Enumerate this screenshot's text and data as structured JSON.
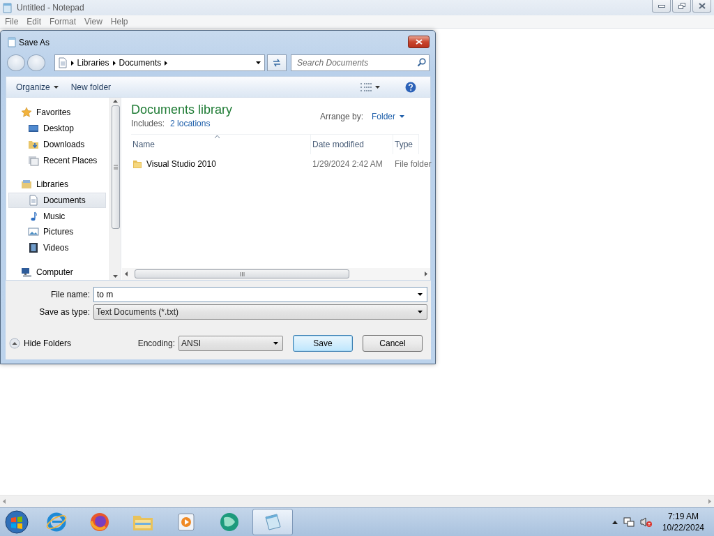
{
  "notepad": {
    "title": "Untitled - Notepad",
    "active": false,
    "menu": [
      "File",
      "Edit",
      "Format",
      "View",
      "Help"
    ]
  },
  "dialog": {
    "title": "Save As",
    "breadcrumb": [
      "Libraries",
      "Documents"
    ],
    "search": {
      "placeholder": "Search Documents"
    },
    "toolbar": {
      "organize": "Organize",
      "new_folder": "New folder"
    },
    "sidebar": [
      {
        "label": "Favorites",
        "kind": "favorites",
        "selected": false,
        "children": [
          {
            "label": "Desktop",
            "kind": "desktop",
            "selected": false
          },
          {
            "label": "Downloads",
            "kind": "downloads",
            "selected": false
          },
          {
            "label": "Recent Places",
            "kind": "recent",
            "selected": false
          }
        ]
      },
      {
        "label": "Libraries",
        "kind": "libraries",
        "selected": false,
        "children": [
          {
            "label": "Documents",
            "kind": "documents",
            "selected": true
          },
          {
            "label": "Music",
            "kind": "music",
            "selected": false
          },
          {
            "label": "Pictures",
            "kind": "pictures",
            "selected": false
          },
          {
            "label": "Videos",
            "kind": "videos",
            "selected": false
          }
        ]
      },
      {
        "label": "Computer",
        "kind": "computer",
        "selected": false
      }
    ],
    "library": {
      "title": "Documents library",
      "includes_label": "Includes:",
      "includes_link": "2 locations",
      "arrange_label": "Arrange by:",
      "arrange_value": "Folder"
    },
    "columns": [
      "Name",
      "Date modified",
      "Type"
    ],
    "rows": [
      {
        "name": "Visual Studio 2010",
        "date": "1/29/2024 2:42 AM",
        "type": "File folder"
      }
    ],
    "file_name": {
      "label": "File name:",
      "value": "to m"
    },
    "save_type": {
      "label": "Save as type:",
      "value": "Text Documents (*.txt)"
    },
    "hide_folders": "Hide Folders",
    "encoding": {
      "label": "Encoding:",
      "value": "ANSI"
    },
    "buttons": [
      {
        "label": "Save",
        "default": true
      },
      {
        "label": "Cancel",
        "default": false
      }
    ]
  },
  "taskbar": {
    "apps": [
      {
        "kind": "ie",
        "selected": false
      },
      {
        "kind": "firefox",
        "selected": false
      },
      {
        "kind": "explorer",
        "selected": false
      },
      {
        "kind": "media",
        "selected": false
      },
      {
        "kind": "globe",
        "selected": false
      },
      {
        "kind": "notepad",
        "selected": true
      }
    ],
    "time": "7:19 AM",
    "date": "10/22/2024"
  }
}
